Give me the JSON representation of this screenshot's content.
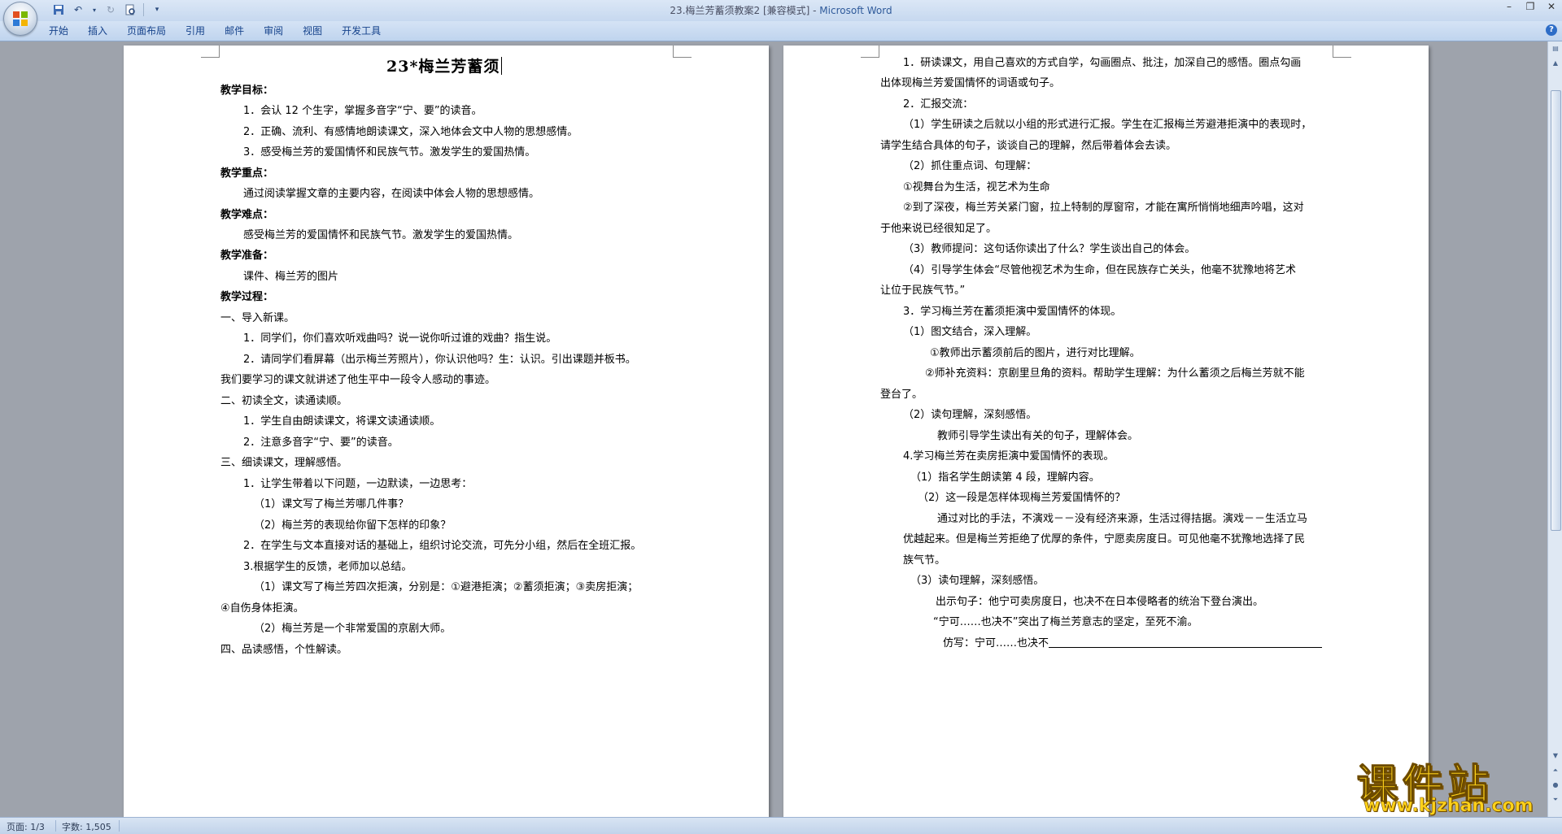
{
  "window": {
    "title_doc": "23.梅兰芳蓄须教案2 [兼容模式]",
    "title_sep": " - ",
    "title_app": "Microsoft Word"
  },
  "ribbon": {
    "tabs": [
      "开始",
      "插入",
      "页面布局",
      "引用",
      "邮件",
      "审阅",
      "视图",
      "开发工具"
    ]
  },
  "left_page": {
    "title": "23*梅兰芳蓄须",
    "lines": [
      "教学目标：",
      "1．会认 12 个生字，掌握多音字“宁、要”的读音。",
      "2．正确、流利、有感情地朗读课文，深入地体会文中人物的思想感情。",
      "3．感受梅兰芳的爱国情怀和民族气节。激发学生的爱国热情。",
      "教学重点：",
      "通过阅读掌握文章的主要内容，在阅读中体会人物的思想感情。",
      "教学难点：",
      "感受梅兰芳的爱国情怀和民族气节。激发学生的爱国热情。",
      "教学准备：",
      "课件、梅兰芳的图片",
      "教学过程：",
      "一、导入新课。",
      "1．同学们，你们喜欢听戏曲吗？说一说你听过谁的戏曲？指生说。",
      "2．请同学们看屏幕（出示梅兰芳照片），你认识他吗？生：认识。引出课题并板书。",
      "我们要学习的课文就讲述了他生平中一段令人感动的事迹。",
      "二、初读全文，读通读顺。",
      "1．学生自由朗读课文，将课文读通读顺。",
      "2．注意多音字“宁、要”的读音。",
      "三、细读课文，理解感悟。",
      "1．让学生带着以下问题，一边默读，一边思考：",
      "（1）课文写了梅兰芳哪几件事？",
      "（2）梅兰芳的表现给你留下怎样的印象？",
      "2．在学生与文本直接对话的基础上，组织讨论交流，可先分小组，然后在全班汇报。",
      "3.根据学生的反馈，老师加以总结。",
      "（1）课文写了梅兰芳四次拒演，分别是：①避港拒演；②蓄须拒演；③卖房拒演；",
      "④自伤身体拒演。",
      "（2）梅兰芳是一个非常爱国的京剧大师。",
      "四、品读感悟，个性解读。"
    ]
  },
  "right_page": {
    "lines": [
      "1．研读课文，用自己喜欢的方式自学，勾画圈点、批注，加深自己的感悟。圈点勾画",
      "出体现梅兰芳爱国情怀的词语或句子。",
      "2．汇报交流：",
      "（1）学生研读之后就以小组的形式进行汇报。学生在汇报梅兰芳避港拒演中的表现时，",
      "请学生结合具体的句子，谈谈自己的理解，然后带着体会去读。",
      "（2）抓住重点词、句理解：",
      "①视舞台为生活，视艺术为生命",
      "②到了深夜，梅兰芳关紧门窗，拉上特制的厚窗帘，才能在寓所悄悄地细声吟唱，这对",
      "于他来说已经很知足了。",
      "（3）教师提问：这句话你读出了什么？学生谈出自己的体会。",
      "（4）引导学生体会“尽管他视艺术为生命，但在民族存亡关头，他毫不犹豫地将艺术",
      "让位于民族气节。”",
      "3．学习梅兰芳在蓄须拒演中爱国情怀的体现。",
      "（1）图文结合，深入理解。",
      "①教师出示蓄须前后的图片，进行对比理解。",
      "②师补充资料：京剧里旦角的资料。帮助学生理解：为什么蓄须之后梅兰芳就不能",
      "登台了。",
      "（2）读句理解，深刻感悟。",
      "教师引导学生读出有关的句子，理解体会。",
      "4.学习梅兰芳在卖房拒演中爱国情怀的表现。",
      "（1）指名学生朗读第 4 段，理解内容。",
      "（2）这一段是怎样体现梅兰芳爱国情怀的？",
      "通过对比的手法，不演戏－－没有经济来源，生活过得拮据。演戏－－生活立马",
      "优越起来。但是梅兰芳拒绝了优厚的条件，宁愿卖房度日。可见他毫不犹豫地选择了民",
      "族气节。",
      "（3）读句理解，深刻感悟。",
      "出示句子：他宁可卖房度日，也决不在日本侵略者的统治下登台演出。",
      "“宁可……也决不”突出了梅兰芳意志的坚定，至死不渝。",
      "仿写：宁可……也决不"
    ]
  },
  "status": {
    "page": "页面: 1/3",
    "words": "字数: 1,505"
  },
  "watermark": {
    "main": "课件站",
    "url": "www.kjzhan.com"
  }
}
